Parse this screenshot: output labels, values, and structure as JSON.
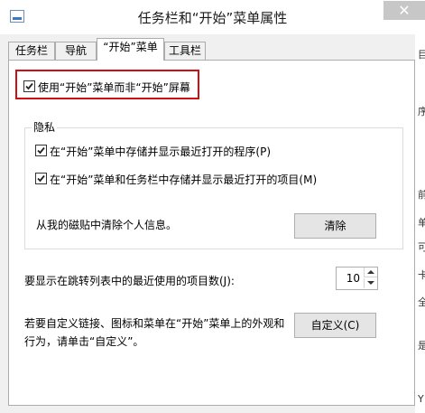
{
  "window": {
    "title": "任务栏和“开始”菜单属性",
    "close_label": "✕"
  },
  "tabs": [
    "任务栏",
    "导航",
    "“开始”菜单",
    "工具栏"
  ],
  "main_option": {
    "label": "使用“开始”菜单而非“开始”屏幕",
    "checked": true
  },
  "privacy": {
    "title": "隐私",
    "options": [
      {
        "label": "在“开始”菜单中存储并显示最近打开的程序(P)",
        "checked": true
      },
      {
        "label": "在“开始”菜单和任务栏中存储并显示最近打开的项目(M)",
        "checked": true
      }
    ],
    "clear_text": "从我的磁贴中清除个人信息。",
    "clear_button": "清除"
  },
  "recent_items": {
    "label": "要显示在跳转列表中的最近使用的项目数(J):",
    "value": "10"
  },
  "customize": {
    "text_line1": "若要自定义链接、图标和菜单在“开始”菜单上的外观和",
    "text_line2": "行为，请单击“自定义”。",
    "button": "自定义(C)"
  },
  "background_fragments": [
    "目",
    "序",
    "前",
    "单",
    "可",
    "卡",
    "全",
    "是",
    "Y"
  ],
  "colors": {
    "highlight_border": "#d01010",
    "accent": "#3a78c9"
  }
}
